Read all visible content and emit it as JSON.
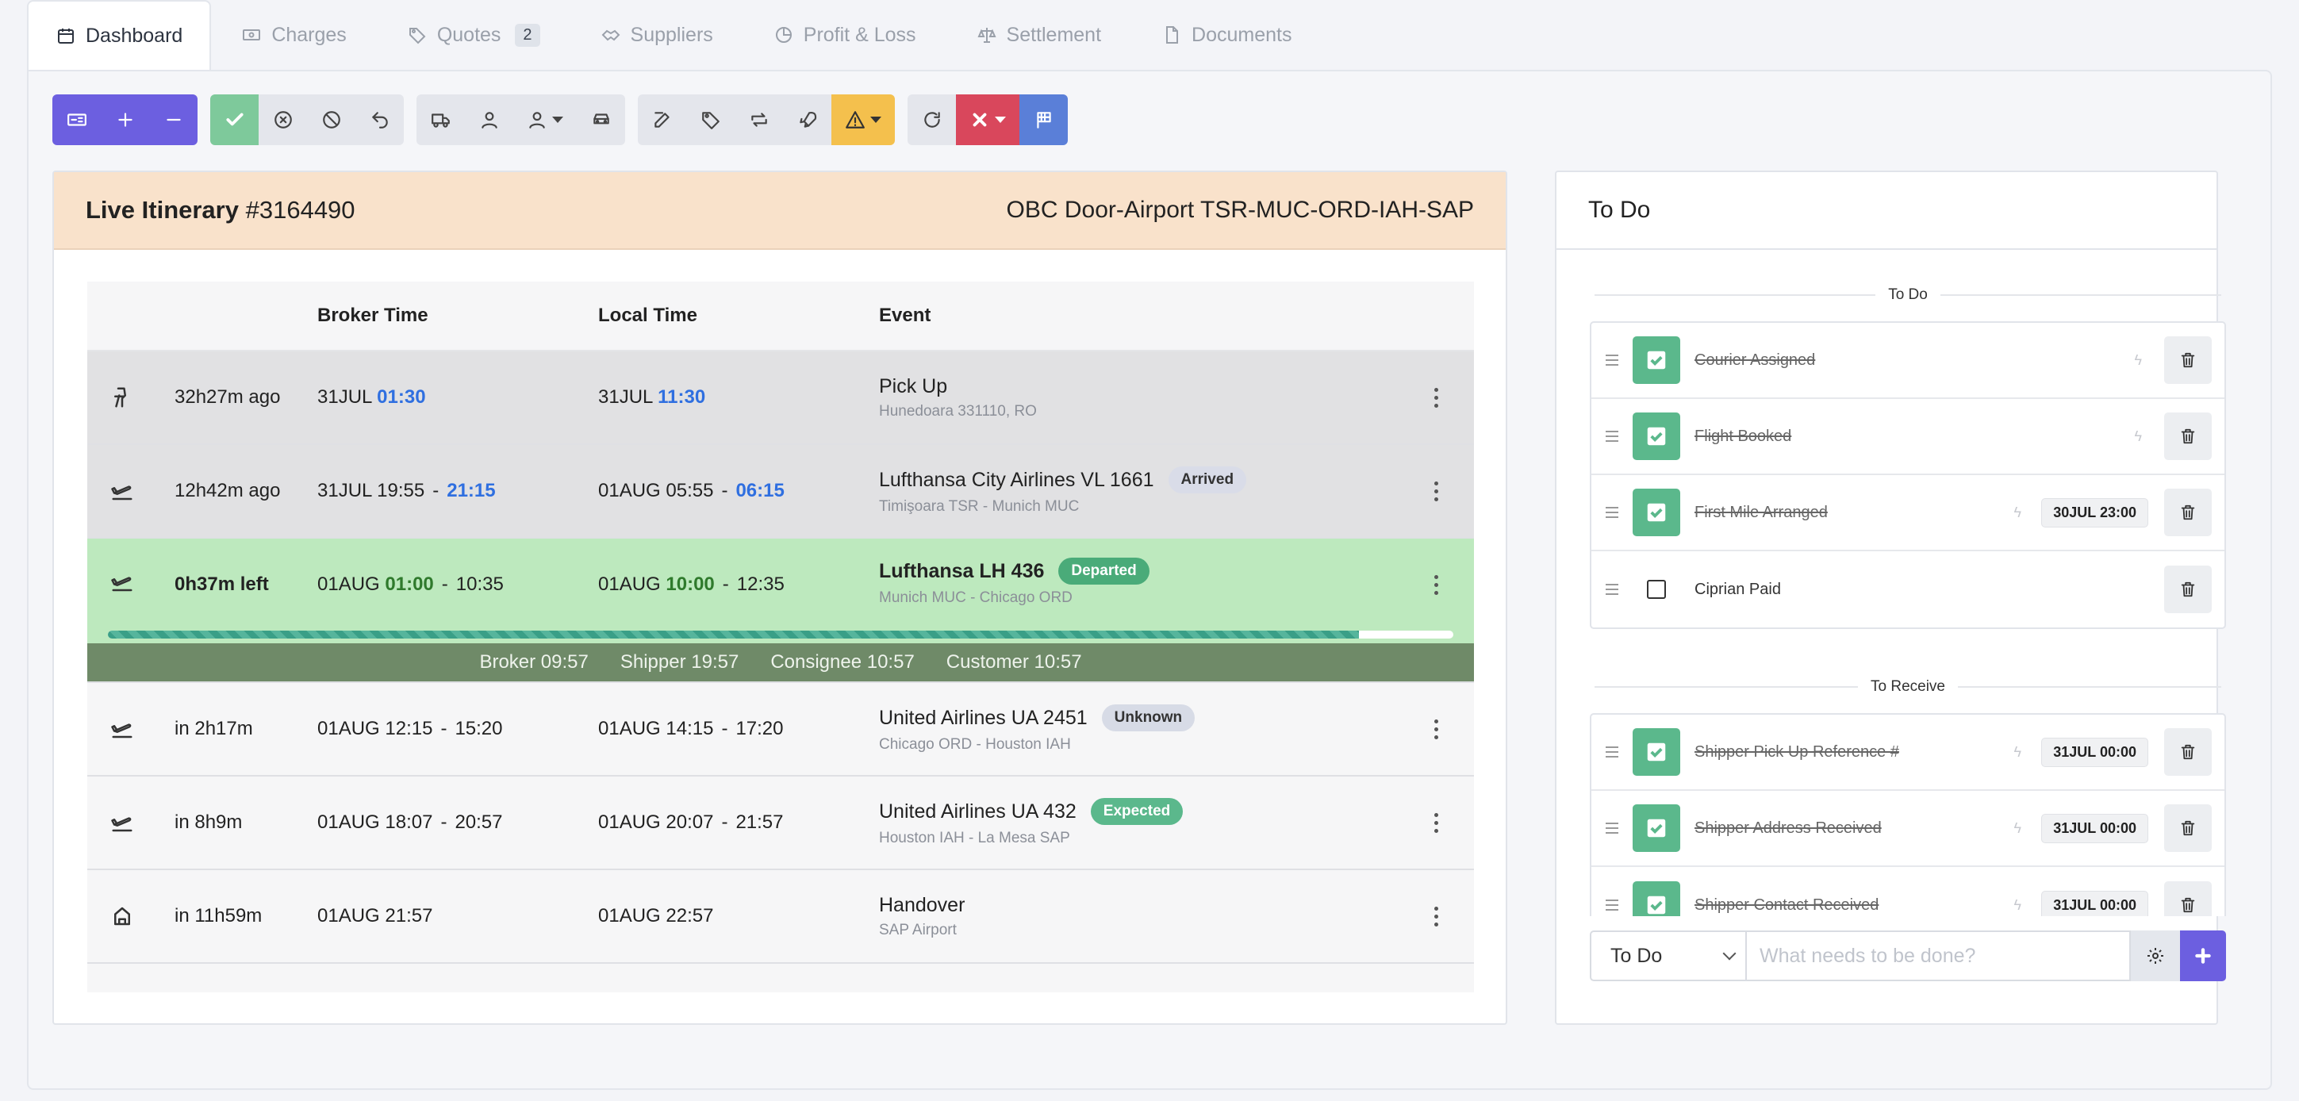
{
  "tabs": [
    {
      "label": "Dashboard",
      "icon": "calendar-icon"
    },
    {
      "label": "Charges",
      "icon": "cash-icon"
    },
    {
      "label": "Quotes",
      "icon": "tag-icon",
      "count": "2"
    },
    {
      "label": "Suppliers",
      "icon": "handshake-icon"
    },
    {
      "label": "Profit & Loss",
      "icon": "pie-chart-icon"
    },
    {
      "label": "Settlement",
      "icon": "scale-icon"
    },
    {
      "label": "Documents",
      "icon": "document-icon"
    }
  ],
  "itinerary": {
    "title_label": "Live Itinerary",
    "title_id": "#3164490",
    "route": "OBC Door-Airport TSR-MUC-ORD-IAH-SAP",
    "columns": [
      "Broker Time",
      "Local Time",
      "Event"
    ],
    "rows": [
      {
        "rel": "32h27m ago",
        "broker_date": "31JUL",
        "broker_time": "01:30",
        "local_date": "31JUL",
        "local_time": "11:30",
        "event": "Pick Up",
        "sub": "Hunedoara 331110, RO"
      },
      {
        "rel": "12h42m ago",
        "broker_date": "31JUL 19:55",
        "broker_time": "21:15",
        "local_date": "01AUG 05:55",
        "local_time": "06:15",
        "event": "Lufthansa City Airlines VL 1661",
        "status": "Arrived",
        "sub": "Timişoara TSR - Munich MUC"
      },
      {
        "rel": "0h37m left",
        "broker_date": "01AUG",
        "broker_time": "01:00",
        "broker_end": "10:35",
        "local_date": "01AUG",
        "local_time": "10:00",
        "local_end": "12:35",
        "event": "Lufthansa LH 436",
        "status": "Departed",
        "sub": "Munich MUC - Chicago ORD",
        "progress": 0.93
      },
      {
        "rel": "in 2h17m",
        "broker": "01AUG 12:15",
        "broker_end": "15:20",
        "local": "01AUG 14:15",
        "local_end": "17:20",
        "event": "United Airlines UA 2451",
        "status": "Unknown",
        "sub": "Chicago ORD - Houston IAH"
      },
      {
        "rel": "in 8h9m",
        "broker": "01AUG 18:07",
        "broker_end": "20:57",
        "local": "01AUG 20:07",
        "local_end": "21:57",
        "event": "United Airlines UA 432",
        "status": "Expected",
        "sub": "Houston IAH - La Mesa SAP"
      },
      {
        "rel": "in 11h59m",
        "broker": "01AUG 21:57",
        "local": "01AUG 22:57",
        "event": "Handover",
        "sub": "SAP Airport"
      }
    ],
    "times_bar": [
      "Broker 09:57",
      "Shipper 19:57",
      "Consignee 10:57",
      "Customer 10:57"
    ]
  },
  "todo": {
    "title": "To Do",
    "section_todo": "To Do",
    "section_receive": "To Receive",
    "todo_items": [
      {
        "label": "Courier Assigned",
        "done": true
      },
      {
        "label": "Flight Booked",
        "done": true
      },
      {
        "label": "First Mile Arranged",
        "done": true,
        "date": "30JUL 23:00"
      },
      {
        "label": "Ciprian Paid",
        "done": false
      }
    ],
    "receive_items": [
      {
        "label": "Shipper Pick Up Reference #",
        "done": true,
        "date": "31JUL 00:00"
      },
      {
        "label": "Shipper Address Received",
        "done": true,
        "date": "31JUL 00:00"
      },
      {
        "label": "Shipper Contact Received",
        "done": true,
        "date": "31JUL 00:00"
      }
    ],
    "select_value": "To Do",
    "input_placeholder": "What needs to be done?"
  }
}
